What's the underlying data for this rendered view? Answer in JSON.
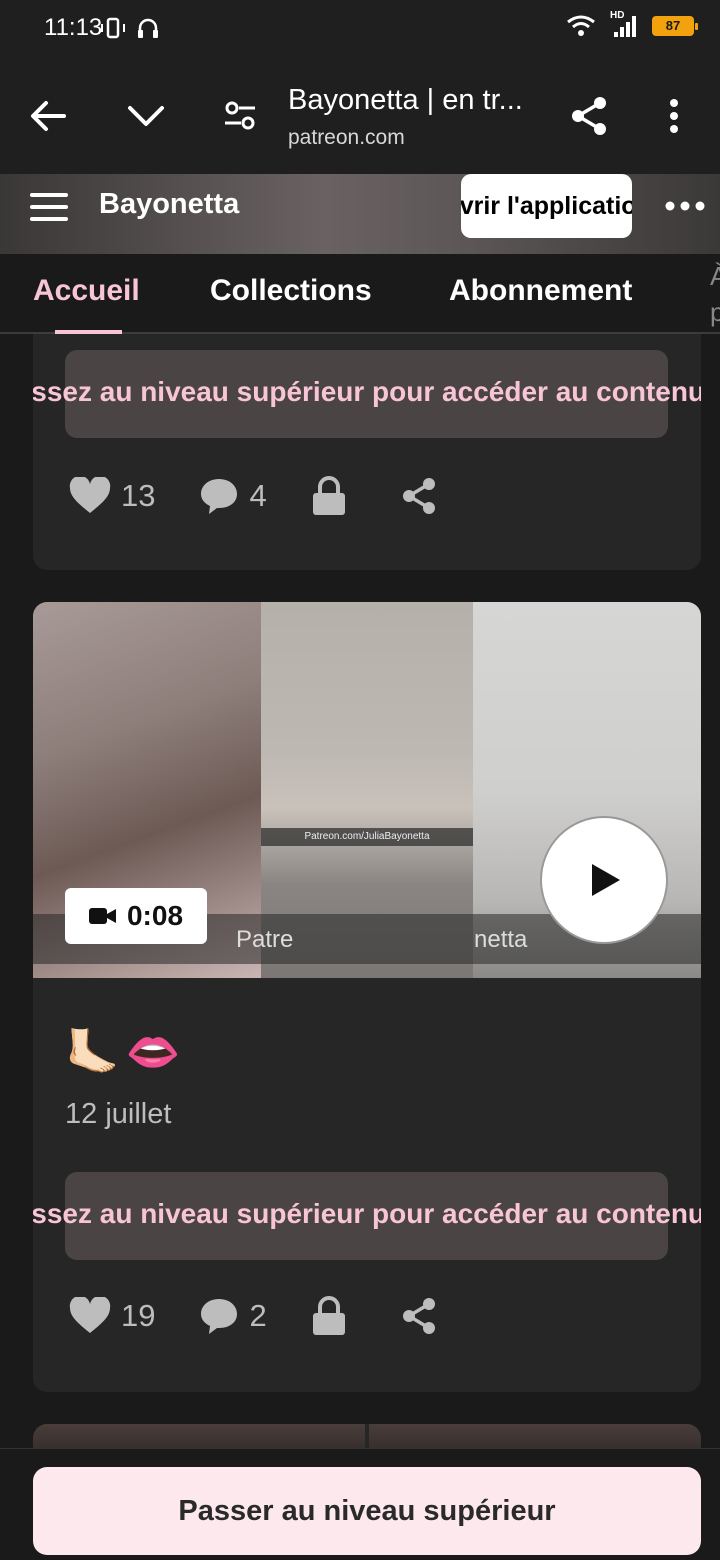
{
  "status_bar": {
    "time": "11:13",
    "battery": "87",
    "network": "HD"
  },
  "browser": {
    "page_title": "Bayonetta | en tr...",
    "host": "patreon.com"
  },
  "creator": {
    "name": "Bayonetta",
    "open_app_label": "Ouvrir l'application"
  },
  "tabs": [
    {
      "label": "Accueil",
      "active": true
    },
    {
      "label": "Collections",
      "active": false
    },
    {
      "label": "Abonnement",
      "active": false
    }
  ],
  "posts": [
    {
      "locked_text": "Passez au niveau supérieur pour accéder au contenu",
      "likes": "13",
      "comments": "4"
    },
    {
      "duration": "0:08",
      "watermark_left": "Patre",
      "watermark_right": "netta",
      "watermark_center": "Patreon.com/JuliaBayonetta",
      "emoji": [
        "🦶🏻",
        "👄"
      ],
      "date": "12 juillet",
      "locked_text": "Passez au niveau supérieur pour accéder au contenu",
      "likes": "19",
      "comments": "2"
    }
  ],
  "cta": {
    "upgrade_label": "Passer au niveau supérieur"
  },
  "colors": {
    "accent_pink": "#f8c5d6",
    "card_bg": "#262626",
    "battery": "#f2a20c"
  }
}
